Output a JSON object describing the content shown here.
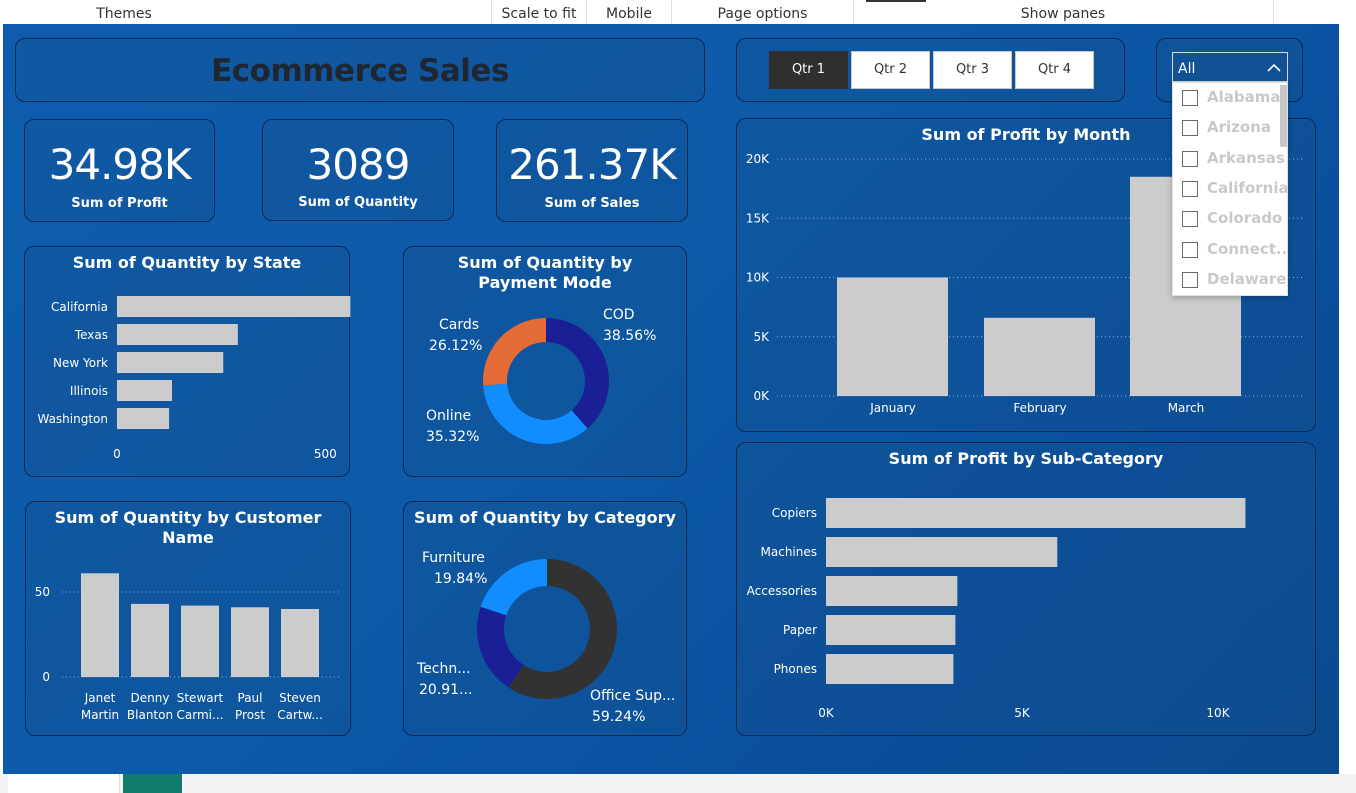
{
  "topbar": {
    "themes": "Themes",
    "scale_to_fit": "Scale to fit",
    "mobile": "Mobile",
    "page_options": "Page options",
    "show_panes": "Show panes"
  },
  "dashboard": {
    "title": "Ecommerce Sales",
    "quarter_buttons": [
      {
        "label": "Qtr 1",
        "selected": true
      },
      {
        "label": "Qtr 2",
        "selected": false
      },
      {
        "label": "Qtr 3",
        "selected": false
      },
      {
        "label": "Qtr 4",
        "selected": false
      }
    ],
    "state_slicer": {
      "selected": "All",
      "options": [
        "Alabama",
        "Arizona",
        "Arkansas",
        "California",
        "Colorado",
        "Connect...",
        "Delaware"
      ]
    },
    "kpis": [
      {
        "value": "34.98K",
        "label": "Sum of Profit"
      },
      {
        "value": "3089",
        "label": "Sum of Quantity"
      },
      {
        "value": "261.37K",
        "label": "Sum of Sales"
      }
    ]
  },
  "colors": {
    "bar": "#cccccc",
    "donut_dark_blue": "#1a1f96",
    "donut_light_blue": "#118dff",
    "donut_orange": "#e66c37",
    "donut_dark_gray": "#323232",
    "text_white": "#ffffff"
  },
  "chart_data": [
    {
      "id": "qty_by_state",
      "type": "bar",
      "orientation": "horizontal",
      "title": "Sum of Quantity by State",
      "categories": [
        "California",
        "Texas",
        "New York",
        "Illinois",
        "Washington"
      ],
      "values": [
        560,
        290,
        255,
        132,
        125
      ],
      "xlim": [
        0,
        600
      ],
      "xticks": [
        "0",
        "500"
      ]
    },
    {
      "id": "qty_by_payment",
      "type": "pie",
      "variant": "donut",
      "title": "Sum of Quantity by Payment Mode",
      "slices": [
        {
          "label": "COD",
          "pct_label": "38.56%",
          "value": 38.56,
          "color": "#1a1f96"
        },
        {
          "label": "Online",
          "pct_label": "35.32%",
          "value": 35.32,
          "color": "#118dff"
        },
        {
          "label": "Cards",
          "pct_label": "26.12%",
          "value": 26.12,
          "color": "#e66c37"
        }
      ]
    },
    {
      "id": "qty_by_customer",
      "type": "bar",
      "orientation": "vertical",
      "title": "Sum of Quantity by Customer Name",
      "categories": [
        [
          "Janet",
          "Martin"
        ],
        [
          "Denny",
          "Blanton"
        ],
        [
          "Stewart",
          "Carmi..."
        ],
        [
          "Paul",
          "Prost"
        ],
        [
          "Steven",
          "Cartw..."
        ]
      ],
      "values": [
        61,
        43,
        42,
        41,
        40
      ],
      "ylim": [
        0,
        70
      ],
      "yticks": [
        0,
        50
      ],
      "grid": true
    },
    {
      "id": "qty_by_category",
      "type": "pie",
      "variant": "donut",
      "title": "Sum of Quantity by Category",
      "slices": [
        {
          "label": "Office Sup...",
          "pct_label": "59.24%",
          "value": 59.24,
          "color": "#323232"
        },
        {
          "label": "Techn...",
          "pct_label": "20.91...",
          "value": 20.91,
          "color": "#1a1f96"
        },
        {
          "label": "Furniture",
          "pct_label": "19.84%",
          "value": 19.84,
          "color": "#118dff"
        }
      ]
    },
    {
      "id": "profit_by_month",
      "type": "bar",
      "orientation": "vertical",
      "title": "Sum of Profit by Month",
      "categories": [
        "January",
        "February",
        "March"
      ],
      "values": [
        10000,
        6600,
        18500
      ],
      "ylim": [
        0,
        20000
      ],
      "yticks": [
        {
          "v": 0,
          "label": "0K"
        },
        {
          "v": 5000,
          "label": "5K"
        },
        {
          "v": 10000,
          "label": "10K"
        },
        {
          "v": 15000,
          "label": "15K"
        },
        {
          "v": 20000,
          "label": "20K"
        }
      ],
      "grid": true
    },
    {
      "id": "profit_by_subcategory",
      "type": "bar",
      "orientation": "horizontal",
      "title": "Sum of Profit by Sub-Category",
      "categories": [
        "Copiers",
        "Machines",
        "Accessories",
        "Paper",
        "Phones"
      ],
      "values": [
        10700,
        5900,
        3350,
        3300,
        3250
      ],
      "xlim": [
        0,
        11000
      ],
      "xticks": [
        {
          "v": 0,
          "label": "0K"
        },
        {
          "v": 5000,
          "label": "5K"
        },
        {
          "v": 10000,
          "label": "10K"
        }
      ]
    }
  ]
}
